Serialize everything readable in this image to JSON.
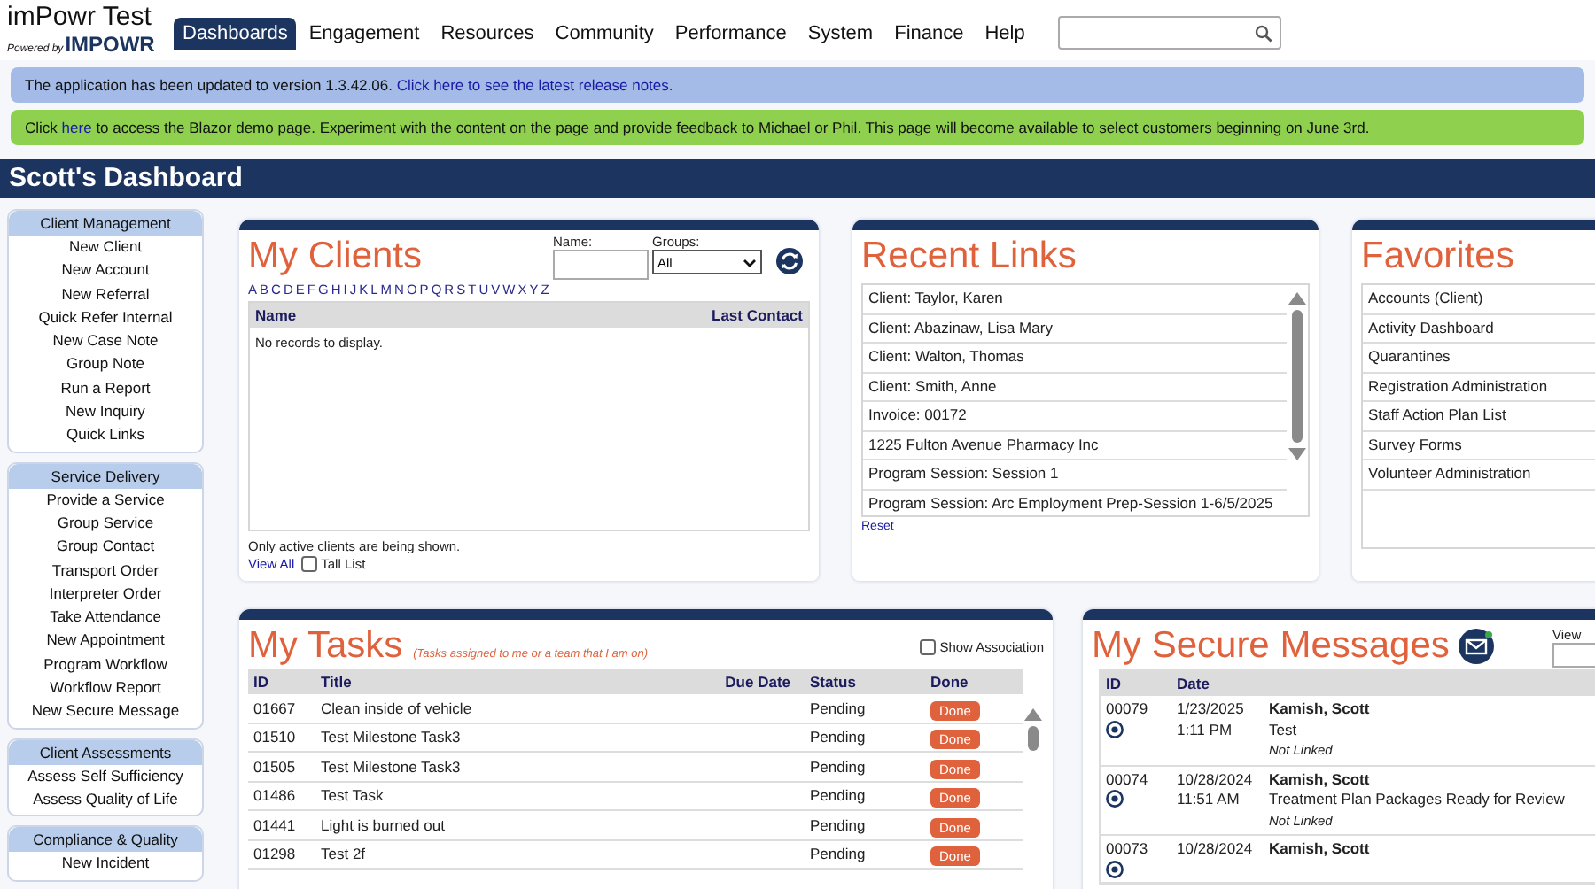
{
  "header": {
    "app_title": "imPowr Test",
    "powered_by": "Powered by",
    "brand": "IMPOWR",
    "nav": [
      {
        "label": "Dashboards",
        "selected": true
      },
      {
        "label": "Engagement",
        "selected": false
      },
      {
        "label": "Resources",
        "selected": false
      },
      {
        "label": "Community",
        "selected": false
      },
      {
        "label": "Performance",
        "selected": false
      },
      {
        "label": "System",
        "selected": false
      },
      {
        "label": "Finance",
        "selected": false
      },
      {
        "label": "Help",
        "selected": false
      }
    ]
  },
  "banners": [
    {
      "kind": "info",
      "parts": [
        {
          "kind": "text",
          "text": "The application has been updated to version 1.3.42.06."
        },
        {
          "kind": "link",
          "text": "Click here to see the latest release notes."
        }
      ]
    },
    {
      "kind": "notice",
      "parts": [
        {
          "kind": "text",
          "text": "Click"
        },
        {
          "kind": "link",
          "text": "here"
        },
        {
          "kind": "text",
          "text": "to access the Blazor demo page. Experiment with the content on the page and provide feedback to Michael or Phil. This page will become available to select customers beginning on June 3rd."
        }
      ]
    }
  ],
  "dashboard_title": "Scott's Dashboard",
  "sidebar": [
    {
      "title": "Client Management",
      "items": [
        "New Client",
        "New Account",
        "New Referral",
        "Quick Refer Internal",
        "New Case Note",
        "Group Note",
        "Run a Report",
        "New Inquiry",
        "Quick Links"
      ]
    },
    {
      "title": "Service Delivery",
      "items": [
        "Provide a Service",
        "Group Service",
        "Group Contact",
        "Transport Order",
        "Interpreter Order",
        "Take Attendance",
        "New Appointment",
        "Program Workflow",
        "Workflow Report",
        "New Secure Message"
      ]
    },
    {
      "title": "Client Assessments",
      "items": [
        "Assess Self Sufficiency",
        "Assess Quality of Life"
      ]
    },
    {
      "title": "Compliance & Quality",
      "items": [
        "New Incident"
      ]
    }
  ],
  "my_clients": {
    "title": "My Clients",
    "name_label": "Name:",
    "groups_label": "Groups:",
    "groups_value": "All",
    "letters": [
      "A",
      "B",
      "C",
      "D",
      "E",
      "F",
      "G",
      "H",
      "I",
      "J",
      "K",
      "L",
      "M",
      "N",
      "O",
      "P",
      "Q",
      "R",
      "S",
      "T",
      "U",
      "V",
      "W",
      "X",
      "Y",
      "Z"
    ],
    "columns": [
      "Name",
      "Last Contact"
    ],
    "empty_message": "No records to display.",
    "note": "Only active clients are being shown.",
    "view_all": "View All",
    "tall_list": {
      "label": "Tall List",
      "checked": false
    }
  },
  "recent_links": {
    "title": "Recent Links",
    "items": [
      "Client: Taylor, Karen",
      "Client: Abazinaw, Lisa Mary",
      "Client: Walton, Thomas",
      "Client: Smith, Anne",
      "Invoice: 00172",
      "1225 Fulton Avenue Pharmacy Inc",
      "Program Session: Session 1",
      "Program Session: Arc Employment Prep-Session 1-6/5/2025"
    ],
    "reset": "Reset"
  },
  "favorites": {
    "title": "Favorites",
    "items": [
      "Accounts (Client)",
      "Activity Dashboard",
      "Quarantines",
      "Registration Administration",
      "Staff Action Plan List",
      "Survey Forms",
      "Volunteer Administration"
    ]
  },
  "my_tasks": {
    "title": "My Tasks",
    "subtitle": "(Tasks assigned to me or a team that I am on)",
    "show_association": {
      "label": "Show Association",
      "checked": false
    },
    "columns": [
      "ID",
      "Title",
      "Due Date",
      "Status",
      "Done"
    ],
    "rows": [
      {
        "id": "01667",
        "title": "Clean inside of vehicle",
        "status": "Pending",
        "action": "Done"
      },
      {
        "id": "01510",
        "title": "Test Milestone Task3",
        "status": "Pending",
        "action": "Done"
      },
      {
        "id": "01505",
        "title": "Test Milestone Task3",
        "status": "Pending",
        "action": "Done"
      },
      {
        "id": "01486",
        "title": "Test Task",
        "status": "Pending",
        "action": "Done"
      },
      {
        "id": "01441",
        "title": "Light is burned out",
        "status": "Pending",
        "action": "Done"
      },
      {
        "id": "01298",
        "title": "Test 2f",
        "status": "Pending",
        "action": "Done"
      }
    ]
  },
  "messages": {
    "title": "My Secure Messages",
    "view_label": "View",
    "columns": [
      "ID",
      "Date"
    ],
    "rows": [
      {
        "id": "00079",
        "date": "1/23/2025",
        "time": "1:11 PM",
        "from": "Kamish, Scott",
        "subject": "Test",
        "link_status": "Not Linked"
      },
      {
        "id": "00074",
        "date": "10/28/2024",
        "time": "11:51 AM",
        "from": "Kamish, Scott",
        "subject": "Treatment Plan Packages Ready for Review",
        "link_status": "Not Linked"
      },
      {
        "id": "00073",
        "date": "10/28/2024",
        "from": "Kamish, Scott"
      }
    ]
  }
}
